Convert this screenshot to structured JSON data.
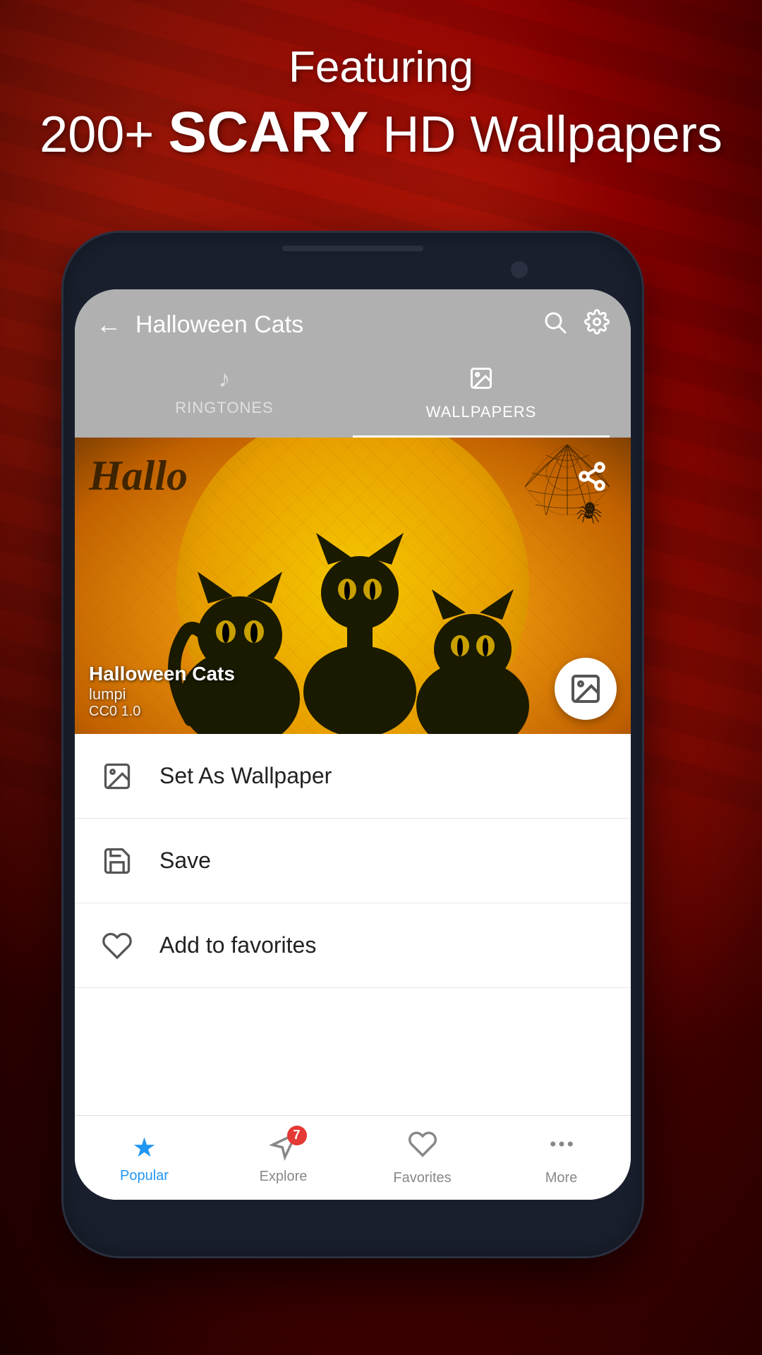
{
  "page": {
    "background": "#8b0000"
  },
  "hero": {
    "line1": "Featuring",
    "line2_prefix": "200+ ",
    "line2_bold": "SCARY",
    "line2_suffix": " HD Wallpapers"
  },
  "app": {
    "header": {
      "title": "Halloween Cats",
      "back_label": "←",
      "search_icon": "search",
      "settings_icon": "settings"
    },
    "tabs": [
      {
        "id": "ringtones",
        "label": "RINGTONES",
        "icon": "♪",
        "active": false
      },
      {
        "id": "wallpapers",
        "label": "WALLPAPERS",
        "icon": "🖼",
        "active": true
      }
    ],
    "wallpaper": {
      "title": "Halloween Cats",
      "author": "lumpi",
      "license": "CC0 1.0"
    },
    "actions": [
      {
        "id": "set-wallpaper",
        "label": "Set As Wallpaper",
        "icon": "wallpaper"
      },
      {
        "id": "save",
        "label": "Save",
        "icon": "save"
      },
      {
        "id": "add-favorites",
        "label": "Add to favorites",
        "icon": "heart"
      }
    ],
    "bottom_nav": [
      {
        "id": "popular",
        "label": "Popular",
        "icon": "★",
        "active": true
      },
      {
        "id": "explore",
        "label": "Explore",
        "icon": "explore",
        "active": false,
        "badge": "7"
      },
      {
        "id": "favorites",
        "label": "Favorites",
        "icon": "♡",
        "active": false
      },
      {
        "id": "more",
        "label": "More",
        "icon": "···",
        "active": false
      }
    ]
  }
}
